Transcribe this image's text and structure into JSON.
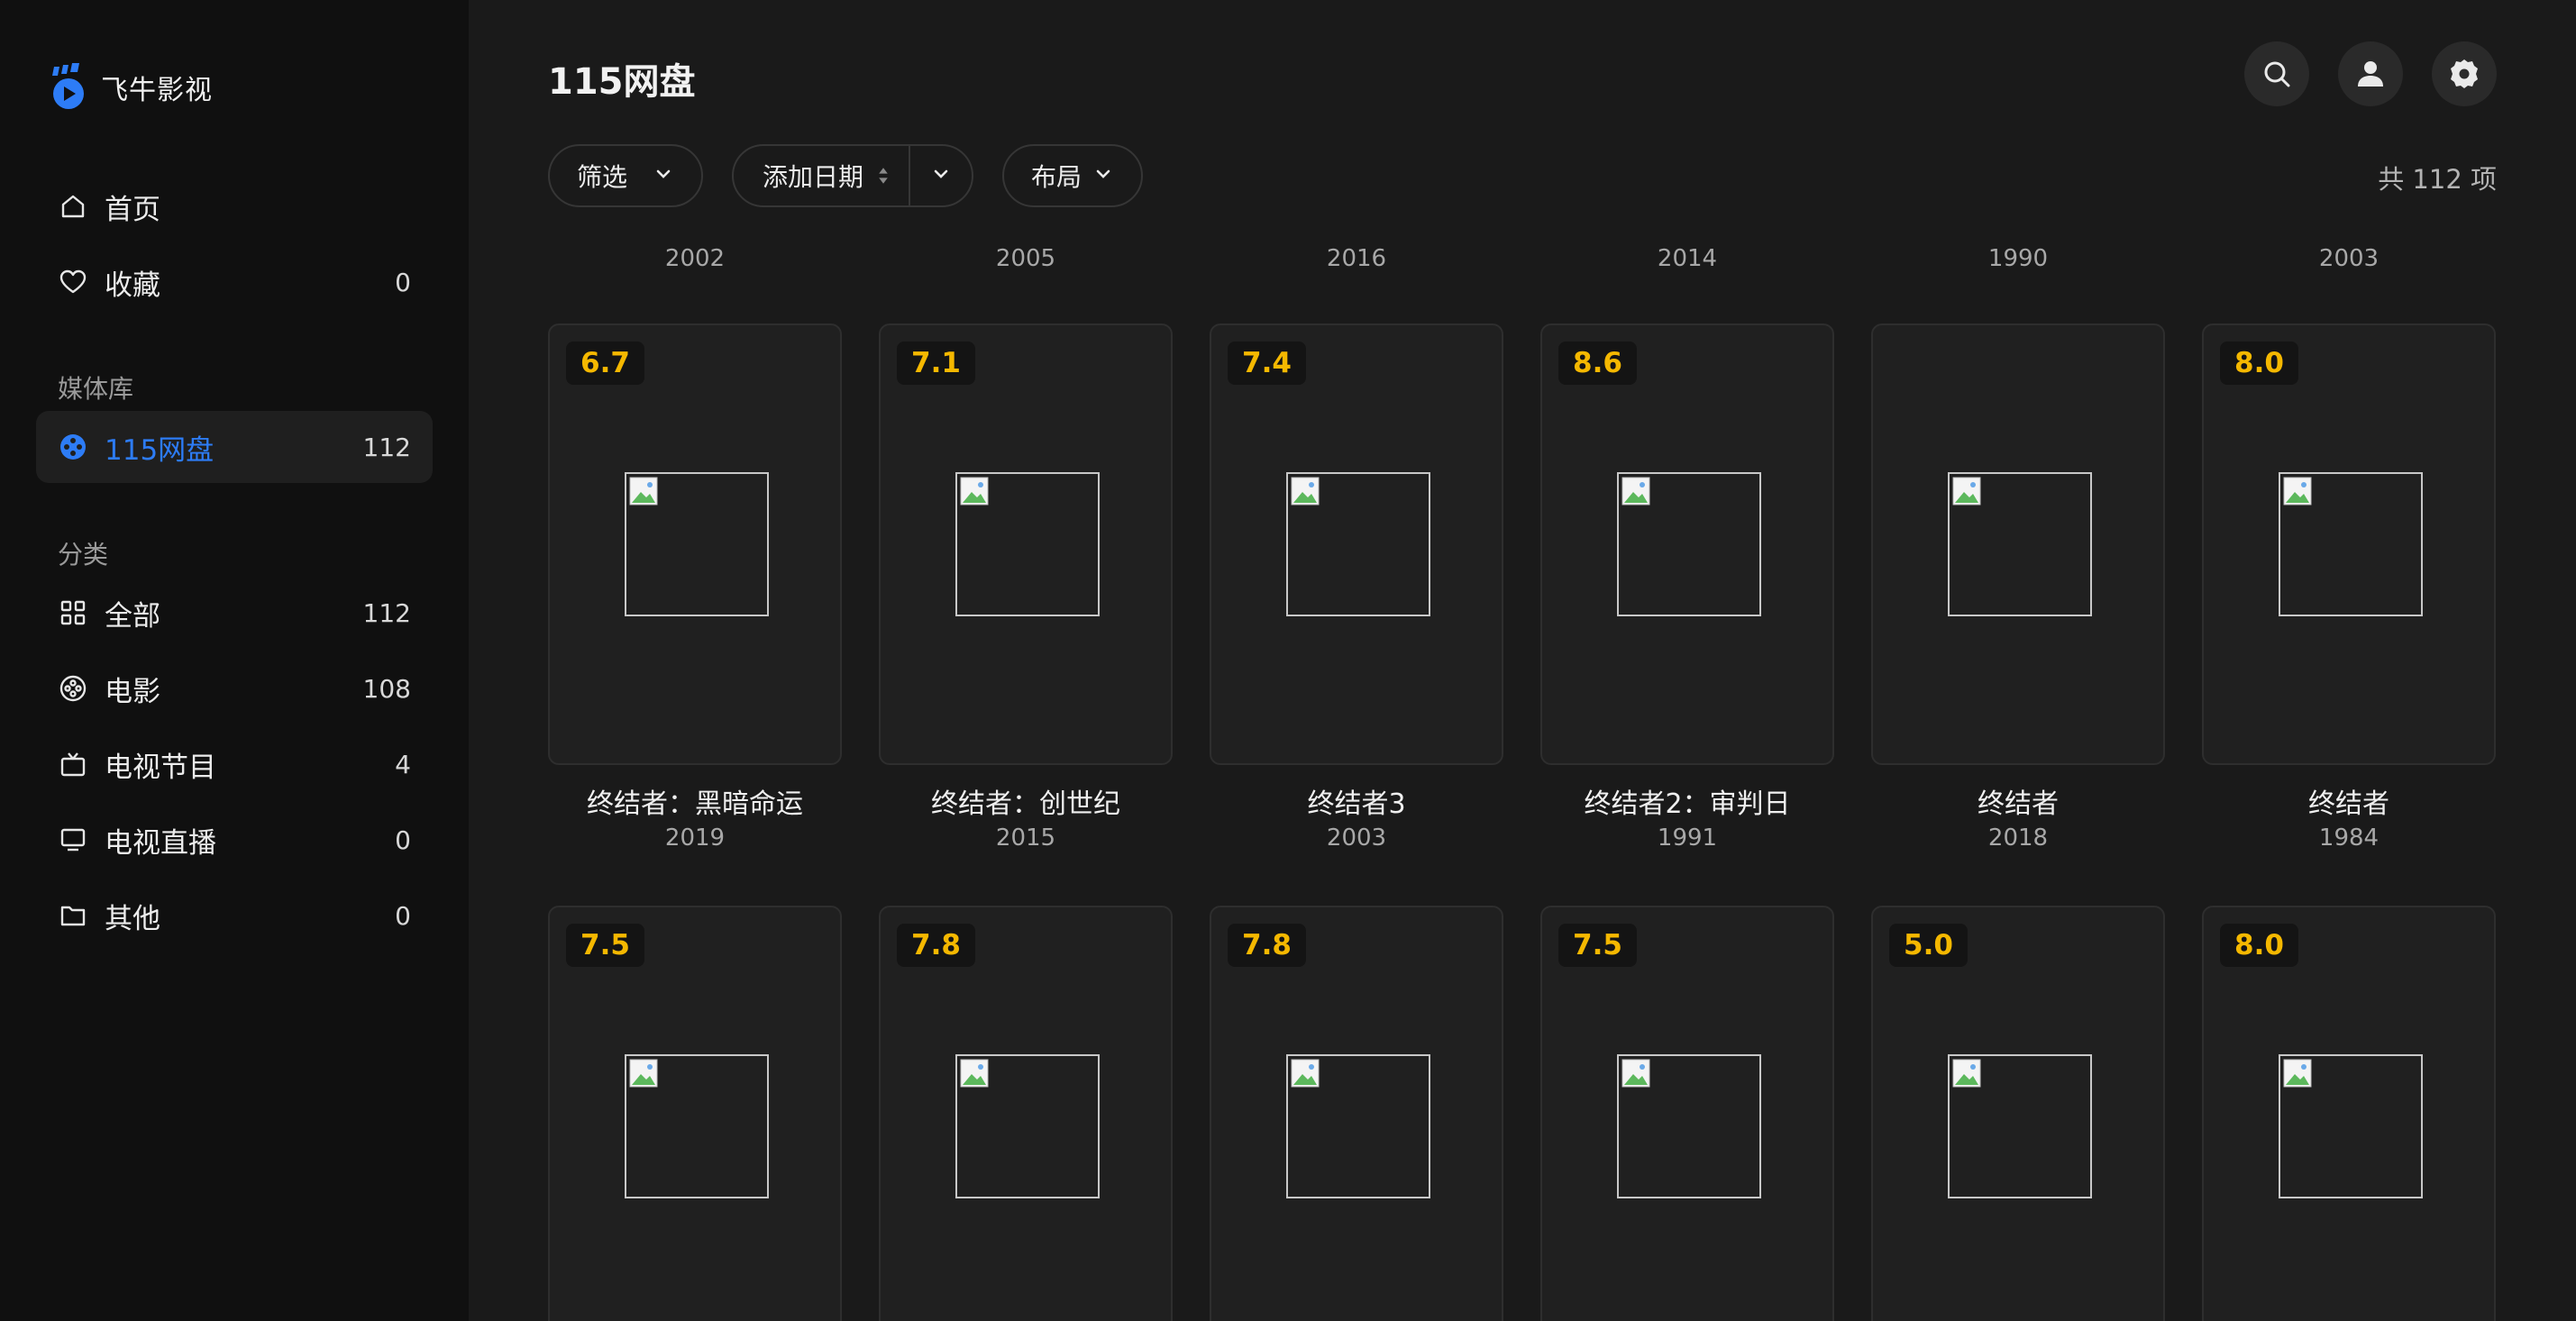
{
  "app": {
    "name": "飞牛影视",
    "accent": "#2d7cf6",
    "rating_color": "#f5b800"
  },
  "sidebar": {
    "nav": [
      {
        "label": "首页",
        "count": "",
        "icon": "home-icon"
      },
      {
        "label": "收藏",
        "count": "0",
        "icon": "heart-icon"
      }
    ],
    "library_section": "媒体库",
    "library": [
      {
        "label": "115网盘",
        "count": "112",
        "icon": "film-reel-icon",
        "active": true
      }
    ],
    "category_section": "分类",
    "categories": [
      {
        "label": "全部",
        "count": "112",
        "icon": "grid-icon"
      },
      {
        "label": "电影",
        "count": "108",
        "icon": "film-reel-icon"
      },
      {
        "label": "电视节目",
        "count": "4",
        "icon": "tv-icon"
      },
      {
        "label": "电视直播",
        "count": "0",
        "icon": "monitor-icon"
      },
      {
        "label": "其他",
        "count": "0",
        "icon": "folder-icon"
      }
    ]
  },
  "header": {
    "title": "115网盘",
    "filter_label": "筛选",
    "sort_label": "添加日期",
    "layout_label": "布局",
    "total": "共 112 项"
  },
  "grid": {
    "previous_row_years": [
      "2002",
      "2005",
      "2016",
      "2014",
      "1990",
      "2003"
    ],
    "row1": [
      {
        "rating": "6.7",
        "title": "终结者：黑暗命运",
        "year": "2019"
      },
      {
        "rating": "7.1",
        "title": "终结者：创世纪",
        "year": "2015"
      },
      {
        "rating": "7.4",
        "title": "终结者3",
        "year": "2003"
      },
      {
        "rating": "8.6",
        "title": "终结者2：审判日",
        "year": "1991"
      },
      {
        "rating": "",
        "title": "终结者",
        "year": "2018"
      },
      {
        "rating": "8.0",
        "title": "终结者",
        "year": "1984"
      }
    ],
    "row2": [
      {
        "rating": "7.5"
      },
      {
        "rating": "7.8"
      },
      {
        "rating": "7.8"
      },
      {
        "rating": "7.5"
      },
      {
        "rating": "5.0"
      },
      {
        "rating": "8.0"
      }
    ]
  }
}
